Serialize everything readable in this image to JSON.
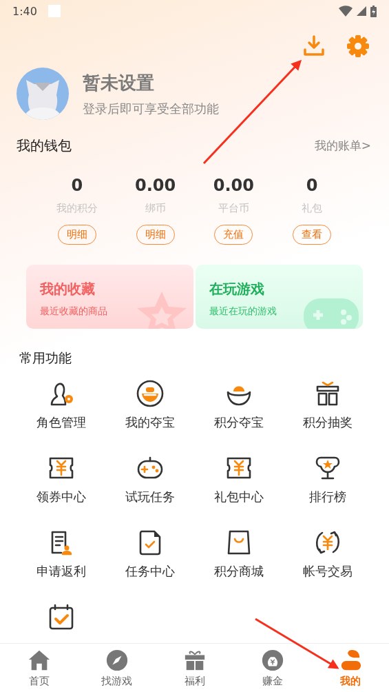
{
  "status_bar": {
    "time": "1:40"
  },
  "profile": {
    "name": "暂未设置",
    "subtitle": "登录后即可享受全部功能"
  },
  "wallet": {
    "title": "我的钱包",
    "link": "我的账单>",
    "items": [
      {
        "value": "0",
        "label": "我的积分",
        "action": "明细"
      },
      {
        "value": "0.00",
        "label": "绑币",
        "action": "明细"
      },
      {
        "value": "0.00",
        "label": "平台币",
        "action": "充值"
      },
      {
        "value": "0",
        "label": "礼包",
        "action": "查看"
      }
    ]
  },
  "cards": [
    {
      "kind": "favorites",
      "title": "我的收藏",
      "subtitle": "最近收藏的商品"
    },
    {
      "kind": "playing",
      "title": "在玩游戏",
      "subtitle": "最近在玩的游戏"
    }
  ],
  "functions": {
    "title": "常用功能",
    "items": [
      {
        "kind": "role",
        "label": "角色管理"
      },
      {
        "kind": "ingot-circle",
        "label": "我的夺宝"
      },
      {
        "kind": "ingot",
        "label": "积分夺宝"
      },
      {
        "kind": "gift",
        "label": "积分抽奖"
      },
      {
        "kind": "coupon",
        "label": "领券中心"
      },
      {
        "kind": "gamepad",
        "label": "试玩任务"
      },
      {
        "kind": "coupon",
        "label": "礼包中心"
      },
      {
        "kind": "trophy",
        "label": "排行榜"
      },
      {
        "kind": "document",
        "label": "申请返利"
      },
      {
        "kind": "task",
        "label": "任务中心"
      },
      {
        "kind": "bag",
        "label": "积分商城"
      },
      {
        "kind": "exchange",
        "label": "帐号交易"
      },
      {
        "kind": "calendar"
      }
    ]
  },
  "nav": [
    {
      "kind": "home",
      "label": "首页",
      "selected": false
    },
    {
      "kind": "compass",
      "label": "找游戏",
      "selected": false
    },
    {
      "kind": "gift",
      "label": "福利",
      "selected": false
    },
    {
      "kind": "money",
      "label": "赚金",
      "selected": false
    },
    {
      "kind": "person",
      "label": "我的",
      "selected": true
    }
  ]
}
